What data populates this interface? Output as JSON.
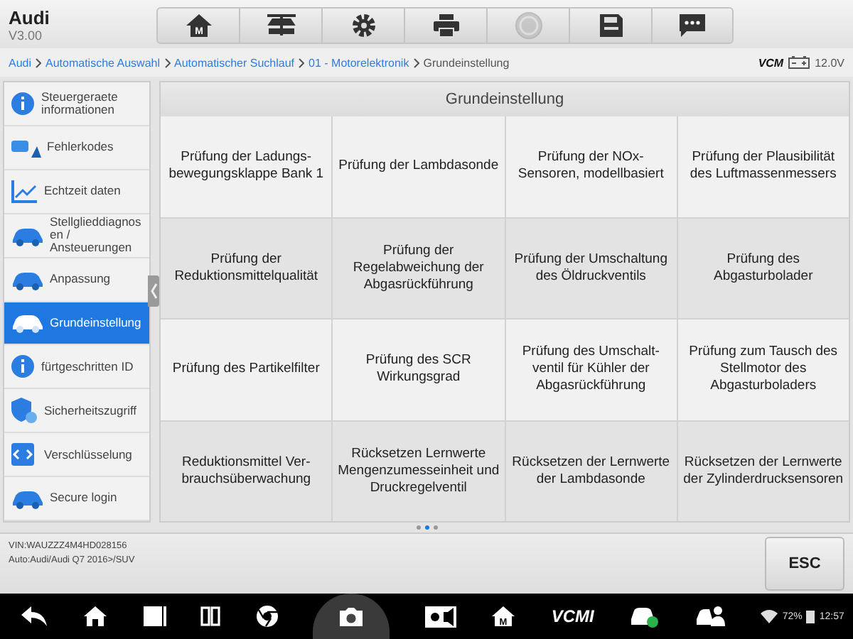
{
  "app": {
    "title": "Audi",
    "version": "V3.00"
  },
  "toolbar": [
    {
      "kind": "home",
      "disabled": false,
      "glyph": "M"
    },
    {
      "kind": "lift",
      "disabled": false
    },
    {
      "kind": "settings",
      "disabled": false
    },
    {
      "kind": "print",
      "disabled": false
    },
    {
      "kind": "help",
      "disabled": true
    },
    {
      "kind": "save",
      "disabled": false
    },
    {
      "kind": "chat",
      "disabled": false
    }
  ],
  "breadcrumb": [
    {
      "label": "Audi",
      "link": true
    },
    {
      "label": "Automatische Auswahl",
      "link": true
    },
    {
      "label": "Automatischer Suchlauf",
      "link": true
    },
    {
      "label": "01 - Motorelektronik",
      "link": true
    },
    {
      "label": "Grundeinstellung",
      "link": false
    }
  ],
  "status": {
    "vcm": "VCM",
    "voltage": "12.0V"
  },
  "sidebar": [
    {
      "label": "Steuergeraete informationen",
      "kind": "info",
      "selected": false
    },
    {
      "label": "Fehlerkodes",
      "kind": "warn",
      "selected": false
    },
    {
      "label": "Echtzeit daten",
      "kind": "chart",
      "selected": false
    },
    {
      "label": "Stellglieddiagnosen / Ansteuerungen",
      "kind": "car",
      "selected": false
    },
    {
      "label": "Anpassung",
      "kind": "car",
      "selected": false
    },
    {
      "label": "Grundeinstellung",
      "kind": "car",
      "selected": true
    },
    {
      "label": "fürtgeschritten ID",
      "kind": "info",
      "selected": false
    },
    {
      "label": "Sicherheitszugriff",
      "kind": "shield",
      "selected": false
    },
    {
      "label": "Verschlüsselung",
      "kind": "code",
      "selected": false
    },
    {
      "label": "Secure login",
      "kind": "car",
      "selected": false
    }
  ],
  "panel": {
    "title": "Grundeinstellung",
    "items": [
      "Prüfung der Ladungs-bewegungsklappe Bank 1",
      "Prüfung der Lambdasonde",
      "Prüfung der NOx-Sensoren, modellbasiert",
      "Prüfung der Plausibilität des Luftmassenmessers",
      "Prüfung der Reduktionsmittelqualität",
      "Prüfung der Regelabweichung der Abgasrückführung",
      "Prüfung der Umschaltung des Öldruckventils",
      "Prüfung des Abgasturbolader",
      "Prüfung des Partikelfilter",
      "Prüfung des SCR Wirkungsgrad",
      "Prüfung des Umschalt-ventil für Kühler der Abgasrückführung",
      "Prüfung zum Tausch des Stellmotor des Abgasturboladers",
      "Reduktionsmittel Ver-brauchsüberwachung",
      "Rücksetzen Lernwerte Mengenzumesseinheit und Druckregelventil",
      "Rücksetzen der Lernwerte der Lambdasonde",
      "Rücksetzen der Lernwerte der Zylinderdrucksensoren"
    ],
    "pages": [
      {
        "selected": false
      },
      {
        "selected": true
      },
      {
        "selected": false
      }
    ]
  },
  "footer": {
    "vin": "VIN:WAUZZZ4M4HD028156",
    "vehicle": "Auto:Audi/Audi Q7 2016>/SUV",
    "esc": "ESC"
  },
  "navbar": {
    "items": [
      {
        "kind": "back"
      },
      {
        "kind": "home"
      },
      {
        "kind": "recent"
      },
      {
        "kind": "split"
      },
      {
        "kind": "browser"
      },
      {
        "kind": "camera",
        "selected": true
      },
      {
        "kind": "brightness"
      },
      {
        "kind": "mhome",
        "glyph": "M"
      },
      {
        "kind": "vcmi",
        "label": "VCMI"
      },
      {
        "kind": "carcheck"
      },
      {
        "kind": "person"
      }
    ],
    "battery": "72%",
    "time": "12:57"
  }
}
